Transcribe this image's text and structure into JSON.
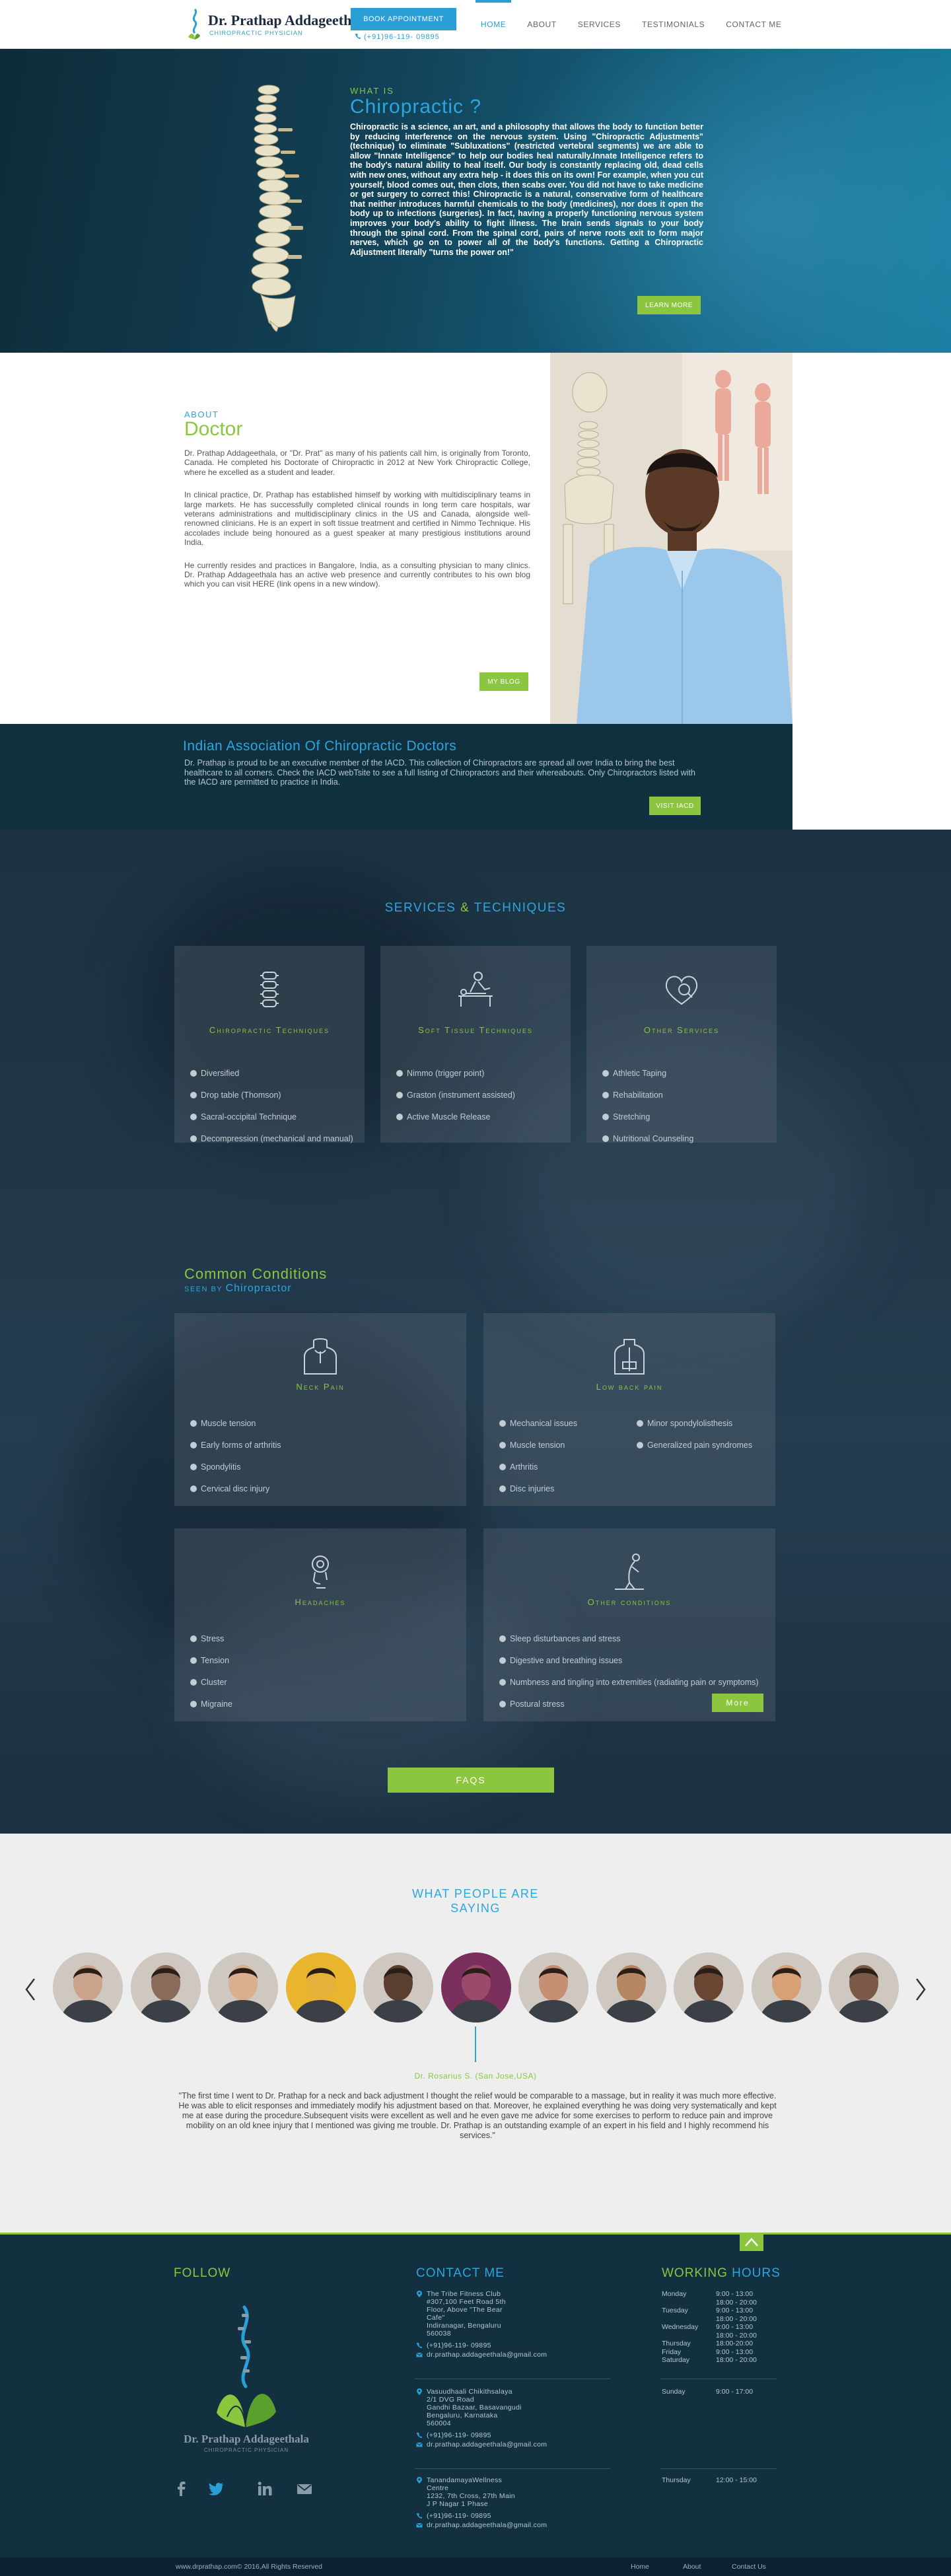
{
  "header": {
    "logo_name": "Dr. Prathap Addageethala",
    "logo_sub": "CHIROPRACTIC PHYSICIAN",
    "book_label": "BOOK APPOINTMENT",
    "phone": "(+91)96-119- 09895",
    "nav": [
      "HOME",
      "ABOUT",
      "SERVICES",
      "TESTIMONIALS",
      "CONTACT ME"
    ],
    "active_nav": "HOME"
  },
  "hero": {
    "eyebrow": "WHAT IS",
    "title": "Chiropractic ?",
    "body": "Chiropractic is a science, an art, and a philosophy that allows the body to function better by reducing interference on the nervous system. Using \"Chiropractic Adjustments\" (technique) to eliminate \"Subluxations\" (restricted vertebral segments) we are able to allow \"Innate Intelligence\" to help our bodies heal naturally.Innate Intelligence refers to the body's natural ability to heal itself. Our body is constantly replacing old, dead cells with new ones, without any extra help - it does this on its own! For example, when you cut yourself, blood comes out, then clots, then scabs over. You did not have to take medicine or get surgery to correct this! Chiropractic is a natural, conservative form of healthcare that neither introduces harmful chemicals to the body (medicines), nor does it open the body up to infections (surgeries). In fact, having a properly functioning nervous system improves your body's ability to fight illness. The brain sends signals to your body through the spinal cord. From the spinal cord, pairs of nerve roots exit to form major nerves, which go on to power all of the body's functions. Getting a Chiropractic Adjustment literally \"turns the power on!\"",
    "button": "LEARN MORE"
  },
  "about": {
    "eyebrow": "ABOUT",
    "title": "Doctor",
    "paragraphs": [
      "Dr. Prathap Addageethala, or \"Dr. Prat\" as many of his patients call him, is originally from Toronto, Canada. He completed his Doctorate of Chiropractic in 2012 at New York Chiropractic College, where he excelled as a student and leader.",
      "In clinical practice, Dr. Prathap has established himself by working with multidisciplinary teams in large markets. He has successfully completed clinical rounds in long term care hospitals, war veterans administrations and multidisciplinary clinics in the US and Canada, alongside well-renowned clinicians.  He is an expert in soft tissue treatment and certified in Nimmo Technique. His accolades include being honoured as a guest speaker at many prestigious institutions around India.",
      "He currently resides and practices in Bangalore, India, as a consulting physician to many clinics. Dr. Prathap Addageethala has an active web presence and currently contributes to his own blog which you can visit HERE (link opens in a new window)."
    ],
    "button": "MY BLOG"
  },
  "iacd": {
    "title": "Indian Association Of Chiropractic Doctors",
    "body": "Dr. Prathap is proud to be an executive member of the IACD. This collection of Chiropractors are spread all over India to bring the best healthcare to all corners. Check the IACD webTsite to see a full listing of Chiropractors and their whereabouts. Only Chiropractors listed with the IACD are permitted to practice in India.",
    "button": "VISIT IACD"
  },
  "services": {
    "title_a": "SERVICES",
    "amp": "&",
    "title_b": "TECHNIQUES",
    "cards": [
      {
        "title": "Chiropractic Techniques",
        "icon": "spine-icon",
        "items": [
          "Diversified",
          "Drop table (Thomson)",
          "Sacral-occipital Technique",
          "Decompression (mechanical and manual)"
        ]
      },
      {
        "title": "Soft Tissue Techniques",
        "icon": "massage-icon",
        "items": [
          "Nimmo (trigger point)",
          "Graston (instrument assisted)",
          "Active Muscle Release"
        ]
      },
      {
        "title": "Other Services",
        "icon": "heart-icon",
        "items": [
          "Athletic Taping",
          "Rehabilitation",
          "Stretching",
          "Nutritional Counseling"
        ]
      }
    ]
  },
  "conditions": {
    "title": "Common Conditions",
    "sub_a": "SEEN BY",
    "sub_b": "Chiropractor",
    "cards": [
      {
        "title": "Neck Pain",
        "icon": "neck-icon",
        "items": [
          "Muscle tension",
          "Early forms of arthritis",
          "Spondylitis",
          "Cervical disc injury"
        ]
      },
      {
        "title": "Low back pain",
        "icon": "back-icon",
        "items": [
          "Mechanical issues",
          "Muscle tension",
          "Arthritis",
          "Disc injuries"
        ],
        "items2": [
          "Minor spondylolisthesis",
          "Generalized pain syndromes"
        ]
      },
      {
        "title": "Headaches",
        "icon": "head-icon",
        "items": [
          "Stress",
          "Tension",
          "Cluster",
          "Migraine"
        ]
      },
      {
        "title": "Other conditions",
        "icon": "posture-icon",
        "items": [
          "Sleep disturbances and stress",
          "Digestive and breathing issues",
          "Numbness and tingling into extremities (radiating pain or symptoms)",
          "Postural stress"
        ]
      }
    ],
    "more": "More",
    "faq": "FAQS"
  },
  "testimonials": {
    "title_1": "WHAT PEOPLE ARE",
    "title_2": "SAYING",
    "name": "Dr. Rosarius S. (San Jose,USA)",
    "quote": "\"The first time I went to Dr. Prathap for a neck and back adjustment I thought the relief would be comparable to a massage, but in reality it was much more effective. He was able to elicit responses and immediately modify his adjustment based on that.  Moreover, he explained everything he was doing very systematically and kept me at ease during the procedure.Subsequent visits were excellent as well and he even gave me advice for some exercises to perform to reduce pain and improve mobility on an old knee injury that I mentioned was giving me trouble.  Dr. Prathap is an outstanding example of an expert in his field and I highly recommend his services.\"",
    "avatars": [
      "#c9a38c",
      "#8a6a58",
      "#d9b08f",
      "#e4b23a",
      "#5a3f30",
      "#9a4a6a",
      "#c58f73",
      "#b58660",
      "#6a4532",
      "#d7a075",
      "#7a5a46"
    ]
  },
  "footer": {
    "follow": "FOLLOW",
    "contact": "CONTACT ME",
    "hours_a": "WORKING",
    "hours_b": "HOURS",
    "logo_name": "Dr. Prathap Addageethala",
    "logo_sub": "CHIROPRACTIC PHYSICIAN",
    "social": [
      "facebook-icon",
      "twitter-icon",
      "linkedin-icon",
      "mail-icon"
    ],
    "locations": [
      {
        "address": [
          "The Tribe Fitness Club",
          "#307,100 Feet Road 5th",
          "Floor, Above \"The Bear",
          "Cafe\"",
          "Indiranagar, Bengaluru",
          "560038"
        ],
        "phone": "(+91)96-119- 09895",
        "email": "dr.prathap.addageethala@gmail.com"
      },
      {
        "address": [
          "Vasuudhaali Chikithsalaya",
          "2/1 DVG Road",
          "Gandhi Bazaar, Basavangudi",
          "Bengaluru, Karnataka",
          "560004"
        ],
        "phone": "(+91)96-119- 09895",
        "email": "dr.prathap.addageethala@gmail.com"
      },
      {
        "address": [
          "TanandamayaWellness",
          "Centre",
          "1232, 7th Cross, 27th Main",
          "J P Nagar 1 Phase"
        ],
        "phone": "(+91)96-119- 09895",
        "email": "dr.prathap.addageethala@gmail.com"
      }
    ],
    "hours_groups": [
      [
        [
          "Monday",
          "9:00 - 13:00"
        ],
        [
          "",
          "18:00 - 20:00"
        ],
        [
          "Tuesday",
          "9:00 - 13:00"
        ],
        [
          "",
          "18:00 - 20:00"
        ],
        [
          "Wednesday",
          "9:00 - 13:00"
        ],
        [
          "",
          "18:00 - 20:00"
        ],
        [
          "Thursday",
          "18:00-20:00"
        ],
        [
          "Friday",
          "9:00 - 13:00"
        ],
        [
          "Saturday",
          "18:00 - 20:00"
        ]
      ],
      [
        [
          "Sunday",
          "9:00 - 17:00"
        ]
      ],
      [
        [
          "Thursday",
          "12:00 - 15:00"
        ]
      ]
    ],
    "copyright": "www.drprathap.com© 2016,All Rights Reserved",
    "bottom_nav": [
      "Home",
      "About",
      "Contact Us"
    ]
  }
}
